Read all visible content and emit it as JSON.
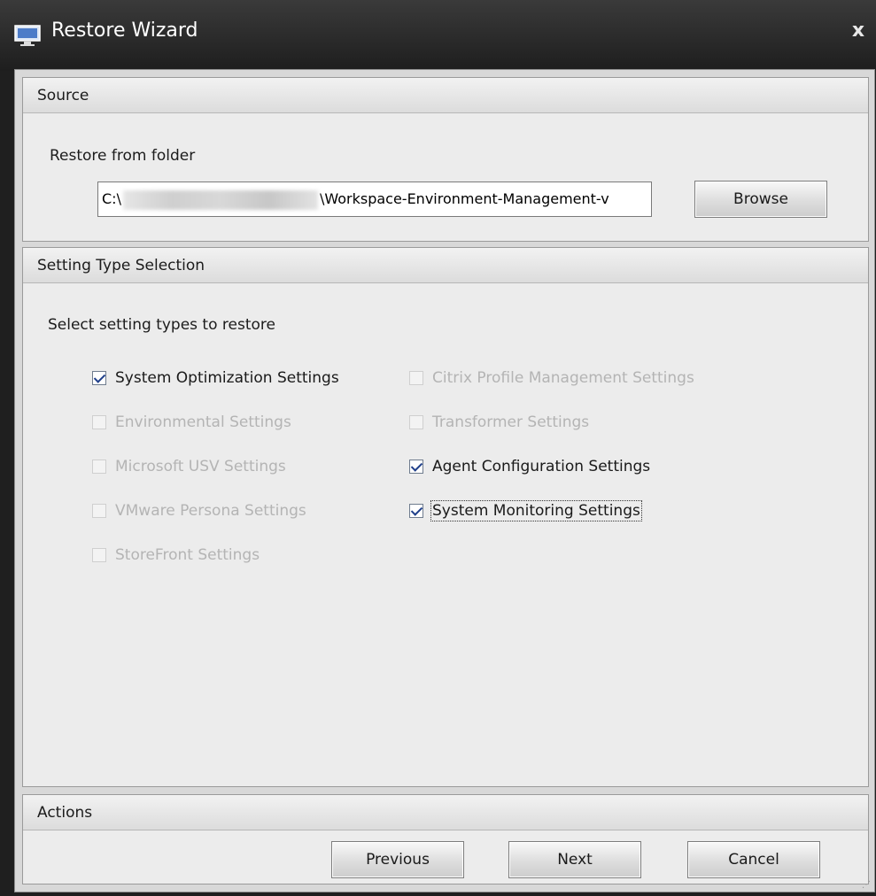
{
  "window": {
    "title": "Restore Wizard",
    "close_label": "x"
  },
  "source": {
    "header": "Source",
    "folder_label": "Restore from folder",
    "path_prefix": "C:\\",
    "path_suffix": "\\Workspace-Environment-Management-v",
    "browse_label": "Browse"
  },
  "selection": {
    "header": "Setting Type Selection",
    "prompt": "Select setting types to restore",
    "items": [
      {
        "label": "System Optimization Settings",
        "checked": true,
        "enabled": true
      },
      {
        "label": "Environmental Settings",
        "checked": false,
        "enabled": false
      },
      {
        "label": "Microsoft USV Settings",
        "checked": false,
        "enabled": false
      },
      {
        "label": "VMware Persona Settings",
        "checked": false,
        "enabled": false
      },
      {
        "label": "StoreFront Settings",
        "checked": false,
        "enabled": false
      },
      {
        "label": "Citrix Profile Management Settings",
        "checked": false,
        "enabled": false
      },
      {
        "label": "Transformer Settings",
        "checked": false,
        "enabled": false
      },
      {
        "label": "Agent Configuration Settings",
        "checked": true,
        "enabled": true
      },
      {
        "label": "System Monitoring Settings",
        "checked": true,
        "enabled": true
      }
    ]
  },
  "actions": {
    "header": "Actions",
    "previous_label": "Previous",
    "next_label": "Next",
    "cancel_label": "Cancel"
  }
}
